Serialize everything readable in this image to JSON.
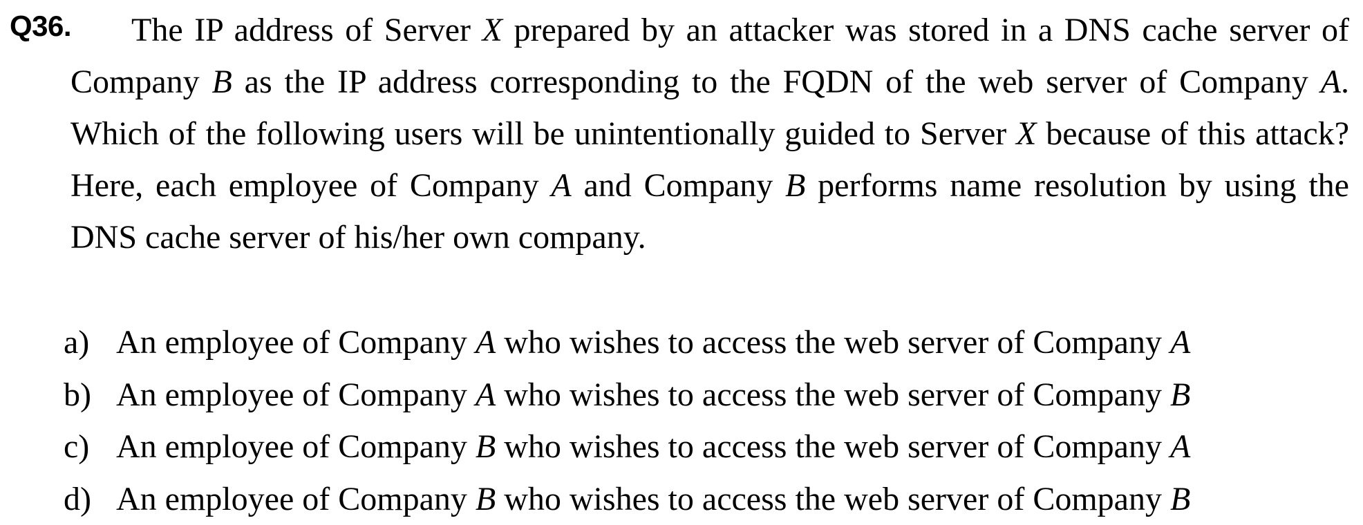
{
  "question": {
    "number": "Q36.",
    "segments": [
      {
        "t": "The IP address of Server ",
        "i": false
      },
      {
        "t": "X",
        "i": true
      },
      {
        "t": " prepared by an attacker was stored in a DNS cache server of Company ",
        "i": false
      },
      {
        "t": "B",
        "i": true
      },
      {
        "t": " as the IP address corresponding to the FQDN of the web server of Company ",
        "i": false
      },
      {
        "t": "A",
        "i": true
      },
      {
        "t": ". Which of the following users will be unintentionally guided to Server ",
        "i": false
      },
      {
        "t": "X",
        "i": true
      },
      {
        "t": " because of this attack? Here, each employee of Company ",
        "i": false
      },
      {
        "t": "A",
        "i": true
      },
      {
        "t": " and Company ",
        "i": false
      },
      {
        "t": "B",
        "i": true
      },
      {
        "t": " performs name resolution by using the DNS cache server of his/her own company.",
        "i": false
      }
    ]
  },
  "options": [
    {
      "letter": "a)",
      "segments": [
        {
          "t": "An employee of Company ",
          "i": false
        },
        {
          "t": "A",
          "i": true
        },
        {
          "t": " who wishes to access the web server of Company ",
          "i": false
        },
        {
          "t": "A",
          "i": true
        }
      ]
    },
    {
      "letter": "b)",
      "segments": [
        {
          "t": "An employee of Company ",
          "i": false
        },
        {
          "t": "A",
          "i": true
        },
        {
          "t": " who wishes to access the web server of Company ",
          "i": false
        },
        {
          "t": "B",
          "i": true
        }
      ]
    },
    {
      "letter": "c)",
      "segments": [
        {
          "t": "An employee of Company ",
          "i": false
        },
        {
          "t": "B",
          "i": true
        },
        {
          "t": " who wishes to access the web server of Company ",
          "i": false
        },
        {
          "t": "A",
          "i": true
        }
      ]
    },
    {
      "letter": "d)",
      "segments": [
        {
          "t": "An employee of Company ",
          "i": false
        },
        {
          "t": "B",
          "i": true
        },
        {
          "t": " who wishes to access the web server of Company ",
          "i": false
        },
        {
          "t": "B",
          "i": true
        }
      ]
    }
  ]
}
